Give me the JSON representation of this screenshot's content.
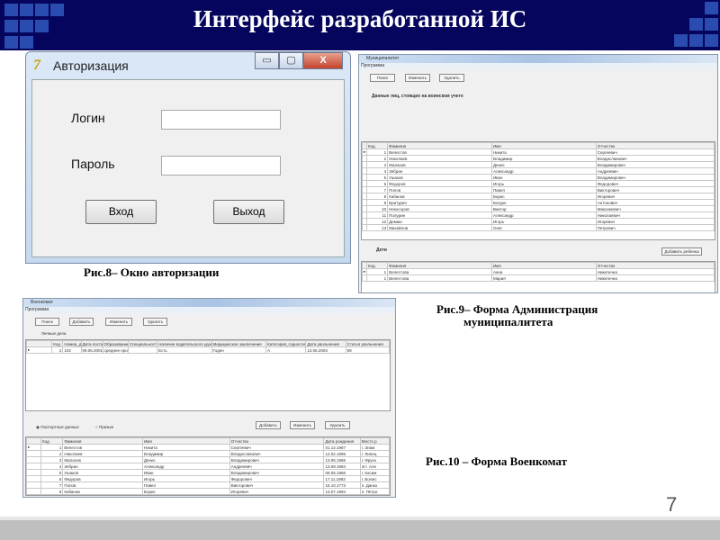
{
  "slide": {
    "title": "Интерфейс разработанной  ИС",
    "page_number": "7"
  },
  "auth": {
    "window_title": "Авторизация",
    "login_label": "Логин",
    "password_label": "Пароль",
    "login_value": "",
    "password_value": "",
    "enter_button": "Вход",
    "exit_button": "Выход",
    "minimize": "▭",
    "maximize": "▢",
    "close": "X"
  },
  "captions": {
    "fig8": "Рис.8– Окно авторизации",
    "fig9_line1": "Рис.9– Форма Администрация",
    "fig9_line2": "муниципалитета",
    "fig10": "Рис.10 – Форма Военкомат"
  },
  "municipality": {
    "window_title": "Муниципалитет",
    "menu": "Программа",
    "buttons": [
      "Поиск",
      "Изменить",
      "Удалить"
    ],
    "heading": "Данные лиц, стоящих на воинском учете",
    "columns": [
      "Код",
      "Фамилия",
      "Имя",
      "Отчество"
    ],
    "rows": [
      [
        "1",
        "Велестов",
        "Никита",
        "Сергеевич"
      ],
      [
        "2",
        "Николаев",
        "Владимир",
        "Владиславович"
      ],
      [
        "3",
        "Малахов",
        "Денис",
        "Владимирович"
      ],
      [
        "4",
        "Зябрин",
        "Александр",
        "Андреевич"
      ],
      [
        "5",
        "Ушаков",
        "Иван",
        "Владимирович"
      ],
      [
        "6",
        "Федоров",
        "Игорь",
        "Федорович"
      ],
      [
        "7",
        "Попов",
        "Павел",
        "Викторович"
      ],
      [
        "8",
        "Кабанов",
        "Борис",
        "Игоревич"
      ],
      [
        "9",
        "Бритурин",
        "Богдан",
        "Антонович"
      ],
      [
        "10",
        "Некосоров",
        "Виктор",
        "Максимович"
      ],
      [
        "11",
        "Полурин",
        "Александр",
        "Николаевич"
      ],
      [
        "12",
        "Демакс",
        "Игорь",
        "Игоревич"
      ],
      [
        "13",
        "Михайлов",
        "Олег",
        "Петрович"
      ]
    ],
    "children_label": "Дети",
    "add_child_button": "Добавить ребенка",
    "children_rows": [
      [
        "1",
        "Велестова",
        "Анна",
        "Никитична"
      ],
      [
        "1",
        "Велестова",
        "Мария",
        "Никитична"
      ]
    ]
  },
  "military": {
    "window_title": "Военкомат",
    "menu": "Программа",
    "buttons": [
      "Поиск",
      "Добавить",
      "Изменить",
      "Удалить"
    ],
    "section": "Личные дела",
    "columns": [
      "Код",
      "Номер_дела",
      "Дата постан",
      "Образование",
      "Специальность",
      "Наличие водительского удостоверения",
      "Медицинское заключение",
      "Категория_годности",
      "Дата увольнения",
      "Статья увольнения"
    ],
    "rows": [
      [
        "2",
        "102",
        "09.06.2001",
        "среднее профессиональное",
        "",
        "Есть",
        "Годен",
        "А",
        "13.06.2003",
        "59"
      ]
    ],
    "radio_passport": "Паспортные данные",
    "radio_call": "Призыв",
    "lower_buttons": [
      "Добавить",
      "Изменить",
      "Удалить"
    ],
    "lower_columns": [
      "Код",
      "Фамилия",
      "Имя",
      "Отчество",
      "Дата рождения",
      "Место р"
    ],
    "lower_rows": [
      [
        "1",
        "Велестов",
        "Никита",
        "Сергеевич",
        "01.12.1987",
        "г. Знам"
      ],
      [
        "2",
        "Николаев",
        "Владимир",
        "Владиславович",
        "12.02.1995",
        "г. Липец"
      ],
      [
        "3",
        "Малахов",
        "Денис",
        "Владимирович",
        "13.06.1986",
        "г. Фрунз"
      ],
      [
        "4",
        "Зябрин",
        "Александр",
        "Андреевич",
        "13.09.1994",
        "пгт. Але"
      ],
      [
        "5",
        "Ушаков",
        "Иван",
        "Владимирович",
        "09.05.1966",
        "г. Касим"
      ],
      [
        "6",
        "Федоров",
        "Игорь",
        "Федорович",
        "17.11.1983",
        "г. Волжс"
      ],
      [
        "7",
        "Попов",
        "Павел",
        "Викторович",
        "16.10.1773",
        "п. Данко"
      ],
      [
        "8",
        "Кабанов",
        "Борис",
        "Игоревич",
        "13.07.1994",
        "п. Петро"
      ]
    ]
  }
}
